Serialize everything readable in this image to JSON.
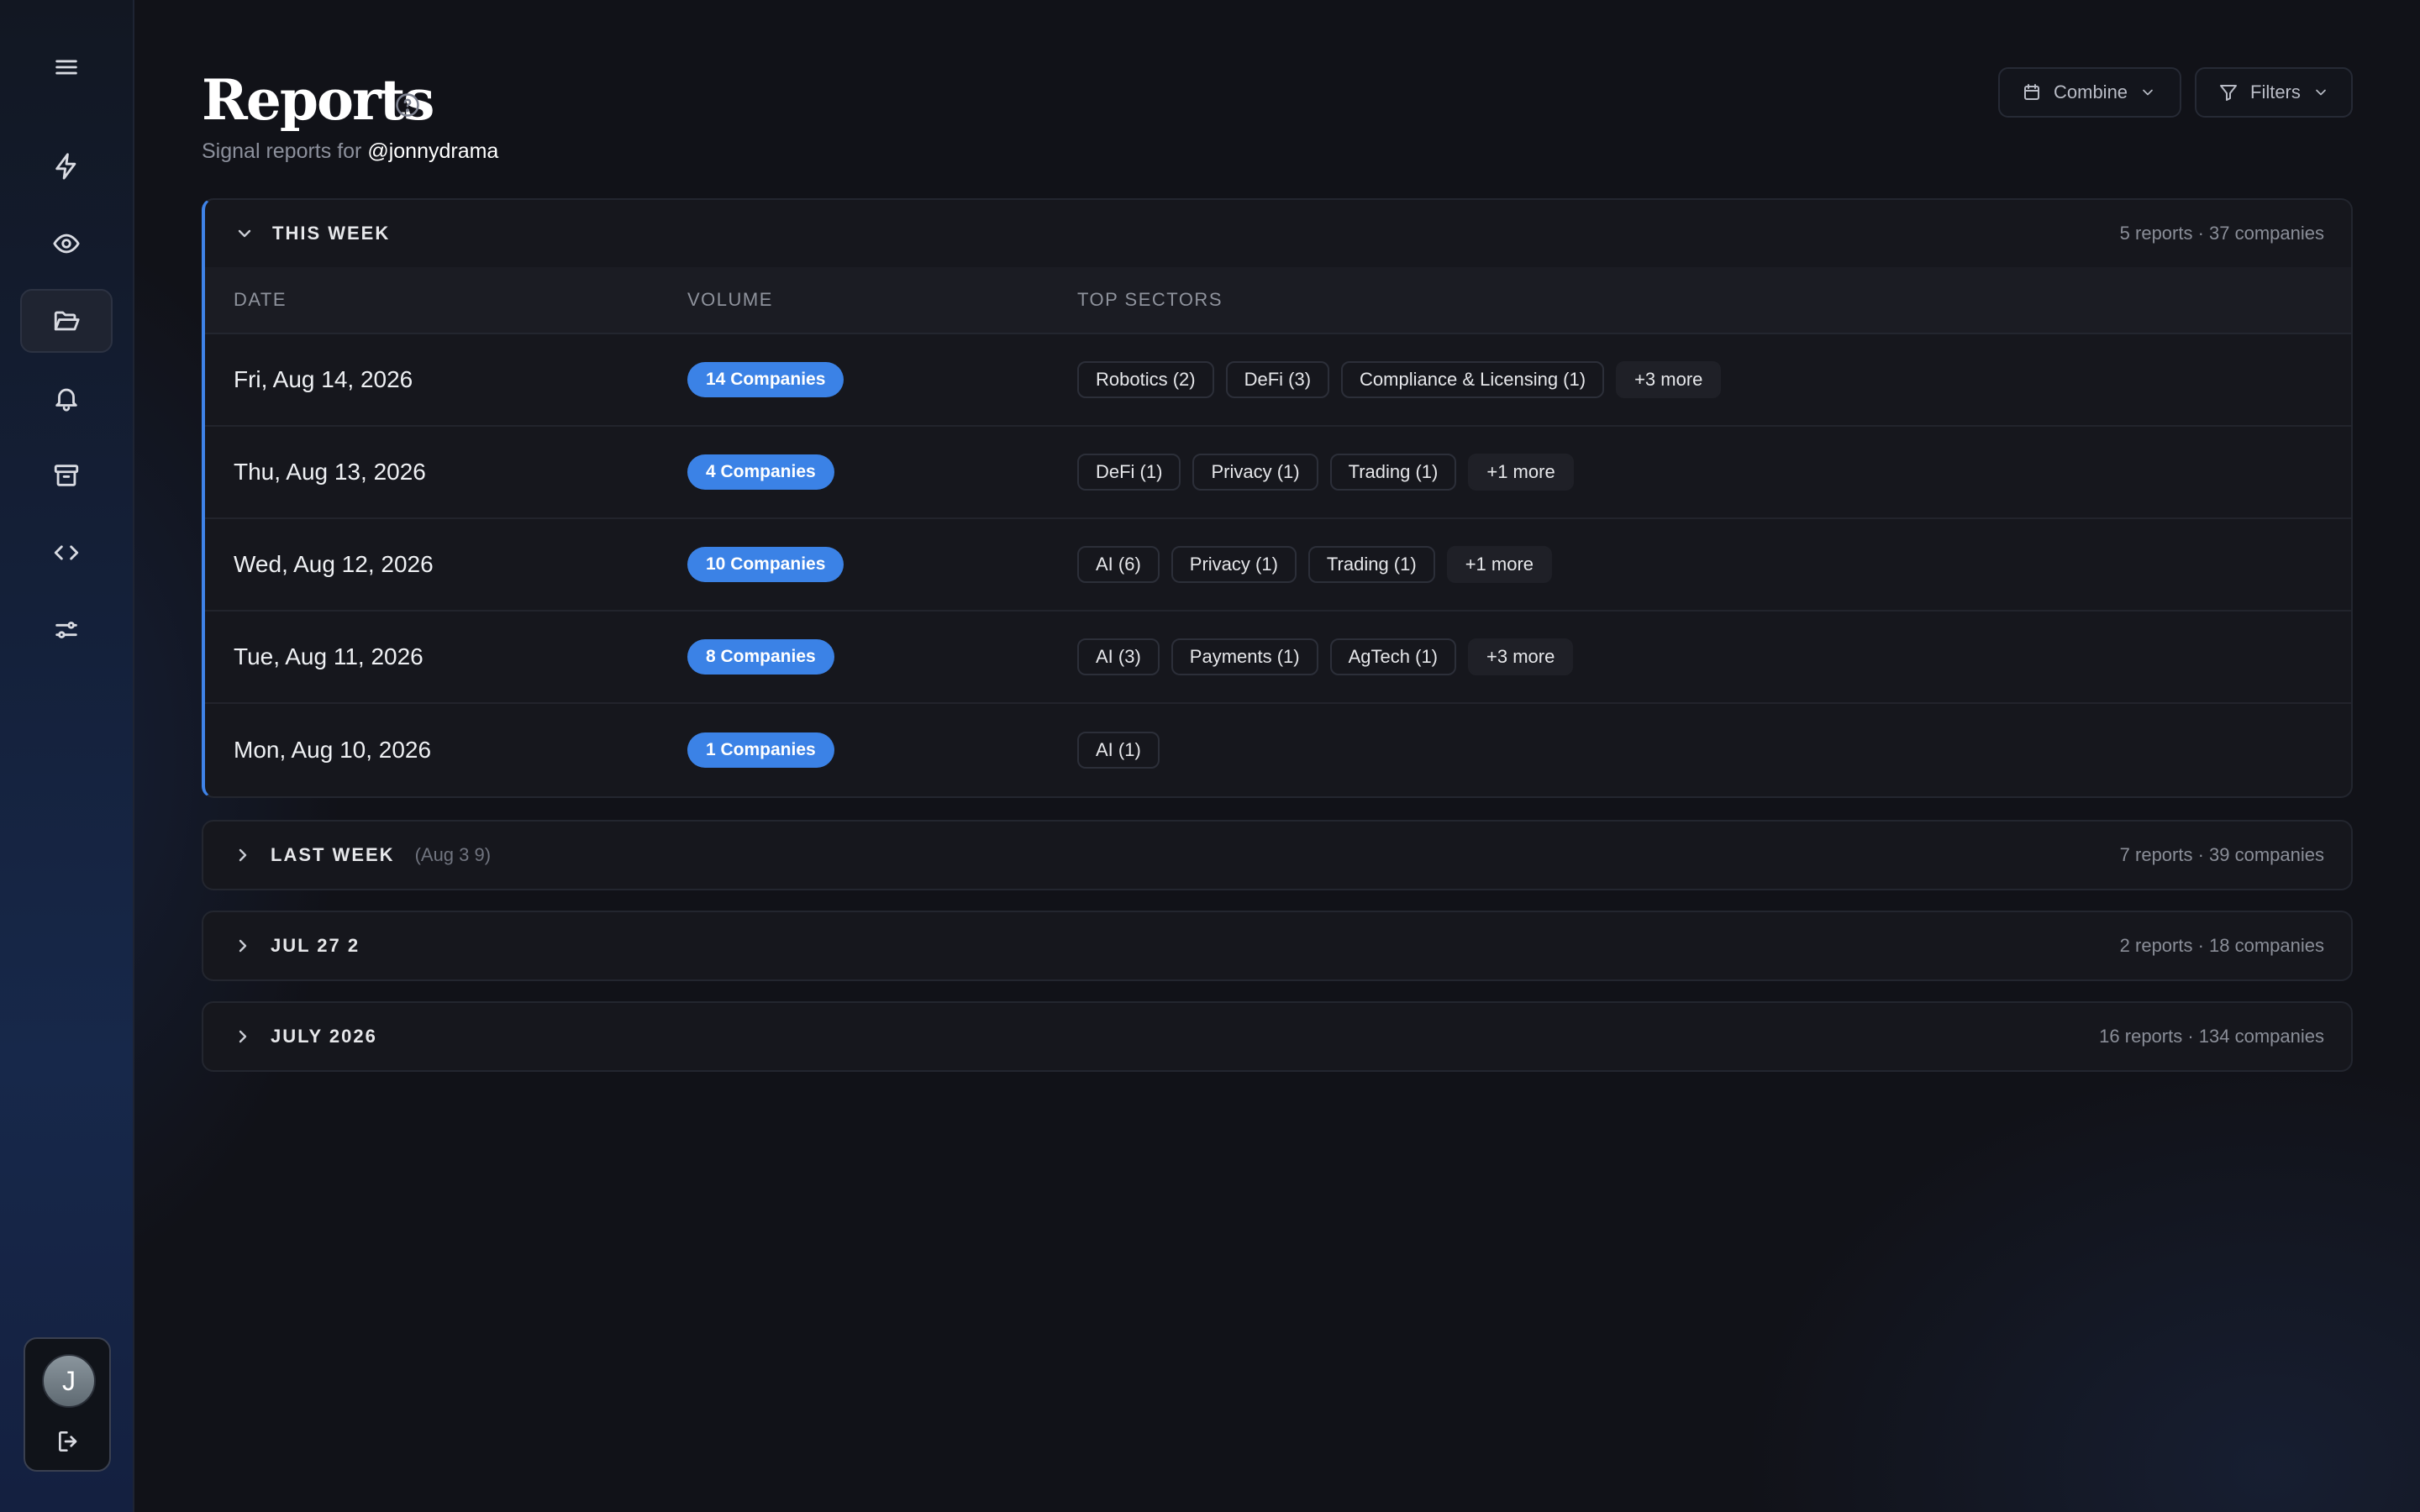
{
  "header": {
    "title": "Reports",
    "subtitle_prefix": "Signal reports for",
    "handle": "@jonnydrama",
    "combine_label": "Combine",
    "filters_label": "Filters"
  },
  "sidebar": {
    "items": [
      {
        "name": "menu",
        "icon": "menu-icon"
      },
      {
        "name": "signals",
        "icon": "lightning-icon"
      },
      {
        "name": "watch",
        "icon": "eye-icon"
      },
      {
        "name": "reports",
        "icon": "folder-open-icon",
        "active": true
      },
      {
        "name": "alerts",
        "icon": "bell-icon"
      },
      {
        "name": "archive",
        "icon": "archive-icon"
      },
      {
        "name": "code",
        "icon": "code-icon"
      },
      {
        "name": "settings",
        "icon": "sliders-icon"
      }
    ],
    "user_initial": "J"
  },
  "this_week": {
    "title": "THIS WEEK",
    "meta": "5 reports · 37 companies",
    "columns": [
      "DATE",
      "VOLUME",
      "TOP SECTORS"
    ],
    "rows": [
      {
        "date": "Fri, Aug 14, 2026",
        "volume": "14 Companies",
        "sectors": [
          "Robotics (2)",
          "DeFi (3)",
          "Compliance & Licensing (1)"
        ],
        "more": "+3 more"
      },
      {
        "date": "Thu, Aug 13, 2026",
        "volume": "4 Companies",
        "sectors": [
          "DeFi (1)",
          "Privacy (1)",
          "Trading (1)"
        ],
        "more": "+1 more"
      },
      {
        "date": "Wed, Aug 12, 2026",
        "volume": "10 Companies",
        "sectors": [
          "AI (6)",
          "Privacy (1)",
          "Trading (1)"
        ],
        "more": "+1 more"
      },
      {
        "date": "Tue, Aug 11, 2026",
        "volume": "8 Companies",
        "sectors": [
          "AI (3)",
          "Payments (1)",
          "AgTech (1)"
        ],
        "more": "+3 more"
      },
      {
        "date": "Mon, Aug 10, 2026",
        "volume": "1 Companies",
        "sectors": [
          "AI (1)"
        ],
        "more": ""
      }
    ]
  },
  "collapsed_groups": [
    {
      "title": "LAST WEEK",
      "range": "(Aug 3 9)",
      "meta": "7 reports · 39 companies"
    },
    {
      "title": "JUL 27 2",
      "range": "",
      "meta": "2 reports · 18 companies"
    },
    {
      "title": "JULY 2026",
      "range": "",
      "meta": "16 reports · 134 companies"
    }
  ]
}
